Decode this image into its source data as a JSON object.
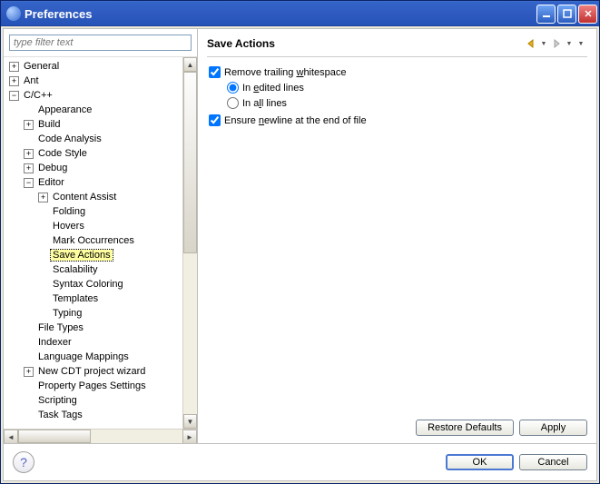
{
  "window": {
    "title": "Preferences"
  },
  "filter": {
    "placeholder": "type filter text"
  },
  "tree": [
    {
      "level": 0,
      "exp": "+",
      "label": "General"
    },
    {
      "level": 0,
      "exp": "+",
      "label": "Ant"
    },
    {
      "level": 0,
      "exp": "-",
      "label": "C/C++"
    },
    {
      "level": 1,
      "exp": "",
      "label": "Appearance"
    },
    {
      "level": 1,
      "exp": "+",
      "label": "Build"
    },
    {
      "level": 1,
      "exp": "",
      "label": "Code Analysis"
    },
    {
      "level": 1,
      "exp": "+",
      "label": "Code Style"
    },
    {
      "level": 1,
      "exp": "+",
      "label": "Debug"
    },
    {
      "level": 1,
      "exp": "-",
      "label": "Editor"
    },
    {
      "level": 2,
      "exp": "+",
      "label": "Content Assist"
    },
    {
      "level": 2,
      "exp": "",
      "label": "Folding"
    },
    {
      "level": 2,
      "exp": "",
      "label": "Hovers"
    },
    {
      "level": 2,
      "exp": "",
      "label": "Mark Occurrences"
    },
    {
      "level": 2,
      "exp": "",
      "label": "Save Actions",
      "selected": true
    },
    {
      "level": 2,
      "exp": "",
      "label": "Scalability"
    },
    {
      "level": 2,
      "exp": "",
      "label": "Syntax Coloring"
    },
    {
      "level": 2,
      "exp": "",
      "label": "Templates"
    },
    {
      "level": 2,
      "exp": "",
      "label": "Typing"
    },
    {
      "level": 1,
      "exp": "",
      "label": "File Types"
    },
    {
      "level": 1,
      "exp": "",
      "label": "Indexer"
    },
    {
      "level": 1,
      "exp": "",
      "label": "Language Mappings"
    },
    {
      "level": 1,
      "exp": "+",
      "label": "New CDT project wizard"
    },
    {
      "level": 1,
      "exp": "",
      "label": "Property Pages Settings"
    },
    {
      "level": 1,
      "exp": "",
      "label": "Scripting"
    },
    {
      "level": 1,
      "exp": "",
      "label": "Task Tags"
    }
  ],
  "page": {
    "title": "Save Actions",
    "opt_remove_ws": {
      "label_pre": "Remove trailing ",
      "label_u": "w",
      "label_post": "hitespace",
      "checked": true
    },
    "opt_in_edited": {
      "label_pre": "In ",
      "label_u": "e",
      "label_post": "dited lines",
      "checked": true
    },
    "opt_in_all": {
      "label_pre": "In a",
      "label_u": "l",
      "label_post": "l lines",
      "checked": false
    },
    "opt_newline": {
      "label_pre": "Ensure ",
      "label_u": "n",
      "label_post": "ewline at the end of file",
      "checked": true
    }
  },
  "buttons": {
    "restore": "Restore Defaults",
    "apply": "Apply",
    "ok": "OK",
    "cancel": "Cancel"
  }
}
